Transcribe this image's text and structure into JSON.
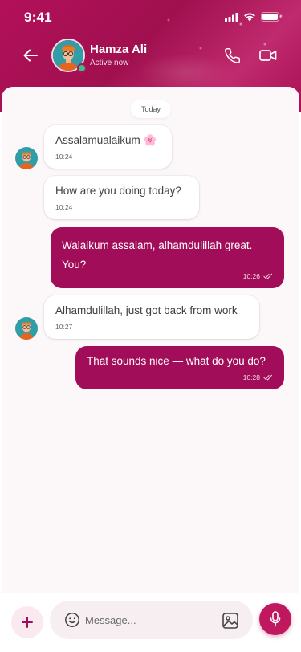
{
  "status_bar": {
    "time": "9:41"
  },
  "contact": {
    "name": "Hamza Ali",
    "status": "Active now"
  },
  "chat": {
    "date_label": "Today",
    "messages": [
      {
        "direction": "in",
        "text": "Assalamualaikum 🌸",
        "time": "10:24"
      },
      {
        "direction": "in",
        "text": "How are you doing today?",
        "time": "10:24"
      },
      {
        "direction": "out",
        "line1": "Walaikum assalam, alhamdulillah great.",
        "line2": "You?",
        "time": "10:26"
      },
      {
        "direction": "in",
        "text": "Alhamdulillah, just got back from work",
        "time": "10:27"
      },
      {
        "direction": "out",
        "text": "That sounds nice — what do you do?",
        "time": "10:28"
      }
    ]
  },
  "composer": {
    "placeholder": "Message..."
  },
  "icons": {
    "back": "arrow-left-icon",
    "call": "phone-icon",
    "video": "video-icon",
    "add": "plus-icon",
    "emoji": "smile-icon",
    "image": "image-icon",
    "mic": "mic-icon",
    "read": "double-check-icon"
  },
  "colors": {
    "accent": "#a10d58",
    "header": "#b3105a",
    "online": "#34c38f",
    "chat_bg": "#fcf7f9"
  }
}
